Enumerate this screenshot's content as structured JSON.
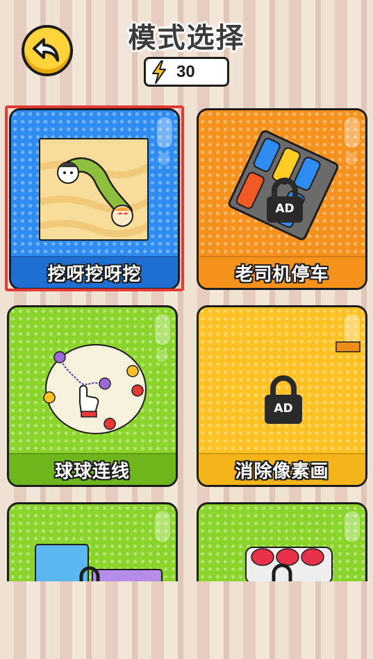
{
  "header": {
    "title": "模式选择",
    "energy_value": "30"
  },
  "modes": [
    {
      "label": "挖呀挖呀挖",
      "color": "#2f8cf0",
      "selected": true,
      "locked": false
    },
    {
      "label": "老司机停车",
      "color": "#f5921e",
      "selected": false,
      "locked": true,
      "lock_text": "AD"
    },
    {
      "label": "球球连线",
      "color": "#8bd42b",
      "selected": false,
      "locked": false
    },
    {
      "label": "消除像素画",
      "color": "#ffc224",
      "selected": false,
      "locked": true,
      "lock_text": "AD"
    },
    {
      "label": "",
      "color": "#8bd42b",
      "selected": false,
      "locked": false
    },
    {
      "label": "",
      "color": "#8bd42b",
      "selected": false,
      "locked": false
    }
  ],
  "colors": {
    "accent_yellow": "#ffd43b",
    "selection_red": "#e53935",
    "outline": "#1d1d1d"
  },
  "icons": [
    "back-arrow-icon",
    "lightning-icon",
    "lock-icon"
  ]
}
